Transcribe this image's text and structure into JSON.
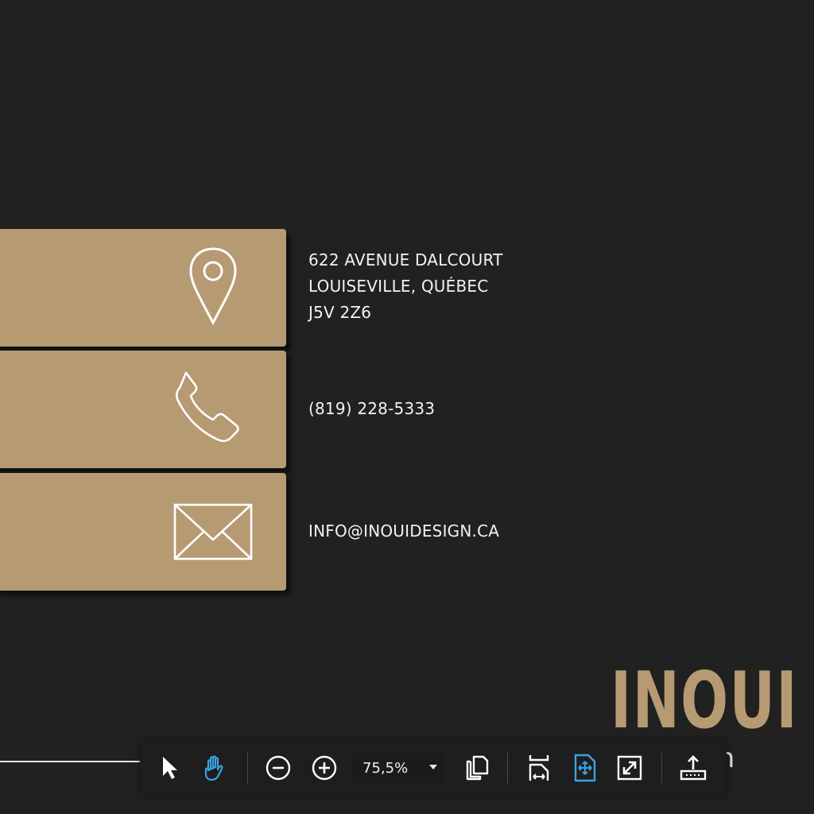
{
  "contact": {
    "address": {
      "icon": "location-pin-icon",
      "lines": [
        "622 AVENUE DALCOURT",
        "LOUISEVILLE, QUÉBEC",
        "J5V 2Z6"
      ]
    },
    "phone": {
      "icon": "phone-icon",
      "text": "(819) 228-5333"
    },
    "email": {
      "icon": "envelope-icon",
      "text": "INFO@INOUIDESIGN.CA"
    }
  },
  "logo": {
    "main": "INOUI",
    "sub": "sign"
  },
  "toolbar": {
    "zoom_value": "75,5%",
    "tools": [
      {
        "name": "select-tool",
        "icon": "cursor-icon"
      },
      {
        "name": "hand-tool",
        "icon": "hand-icon",
        "active": true
      },
      {
        "name": "zoom-out",
        "icon": "zoom-out-icon"
      },
      {
        "name": "zoom-in",
        "icon": "zoom-in-icon"
      },
      {
        "name": "page-view",
        "icon": "pages-icon"
      },
      {
        "name": "fit-width",
        "icon": "fit-width-icon"
      },
      {
        "name": "fit-page",
        "icon": "fit-page-icon",
        "active": true
      },
      {
        "name": "full-screen",
        "icon": "expand-icon"
      },
      {
        "name": "share",
        "icon": "upload-icon"
      }
    ]
  },
  "colors": {
    "background": "#212121",
    "card": "#b69a72",
    "accent_blue": "#3aa3e3",
    "text": "#f2f2f2"
  }
}
